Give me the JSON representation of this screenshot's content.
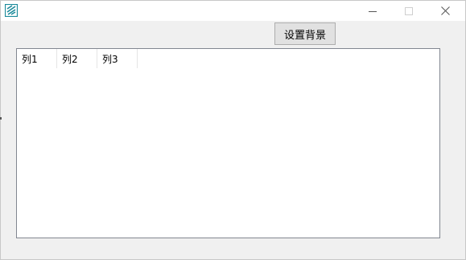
{
  "window": {
    "title": ""
  },
  "icons": {
    "app": "app-logo-icon",
    "minimize": "minimize-icon",
    "maximize": "maximize-icon",
    "close": "close-icon"
  },
  "toolbar": {
    "set_background_label": "设置背景"
  },
  "list": {
    "columns": [
      "列1",
      "列2",
      "列3"
    ],
    "rows": []
  },
  "colors": {
    "titlebar": "#ffffff",
    "client": "#f0f0f0",
    "icon_teal": "#1a8a9a"
  }
}
